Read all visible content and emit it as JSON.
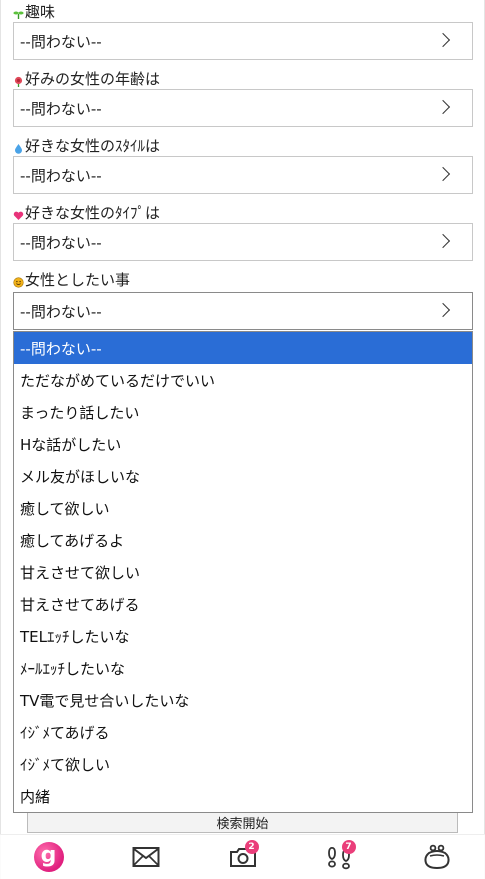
{
  "fields": [
    {
      "label": "趣味",
      "value": "--問わない--",
      "icon": "sprout-icon"
    },
    {
      "label": "好みの女性の年齢は",
      "value": "--問わない--",
      "icon": "rose-icon"
    },
    {
      "label": "好きな女性のｽﾀｲﾙは",
      "value": "--問わない--",
      "icon": "droplet-icon"
    },
    {
      "label": "好きな女性のﾀｲﾌﾟは",
      "value": "--問わない--",
      "icon": "heart-icon"
    },
    {
      "label": "女性としたい事",
      "value": "--問わない--",
      "icon": "smile-icon"
    }
  ],
  "dropdown": {
    "selected_index": 0,
    "options": [
      "--問わない--",
      "ただながめているだけでいい",
      "まったり話したい",
      "Hな話がしたい",
      "メル友がほしいな",
      "癒して欲しい",
      "癒してあげるよ",
      "甘えさせて欲しい",
      "甘えさせてあげる",
      "TELｴｯﾁしたいな",
      "ﾒｰﾙｴｯﾁしたいな",
      "TV電で見せ合いしたいな",
      "ｲｼﾞﾒてあげる",
      "ｲｼﾞﾒて欲しい",
      "内緒"
    ]
  },
  "search_button": "検索開始",
  "tabbar": {
    "logo_letter": "g",
    "camera_badge": "2",
    "footprints_badge": "7"
  },
  "colors": {
    "highlight": "#2a6dd6",
    "badge": "#ea3e7a",
    "logo": "#e01f7e"
  }
}
